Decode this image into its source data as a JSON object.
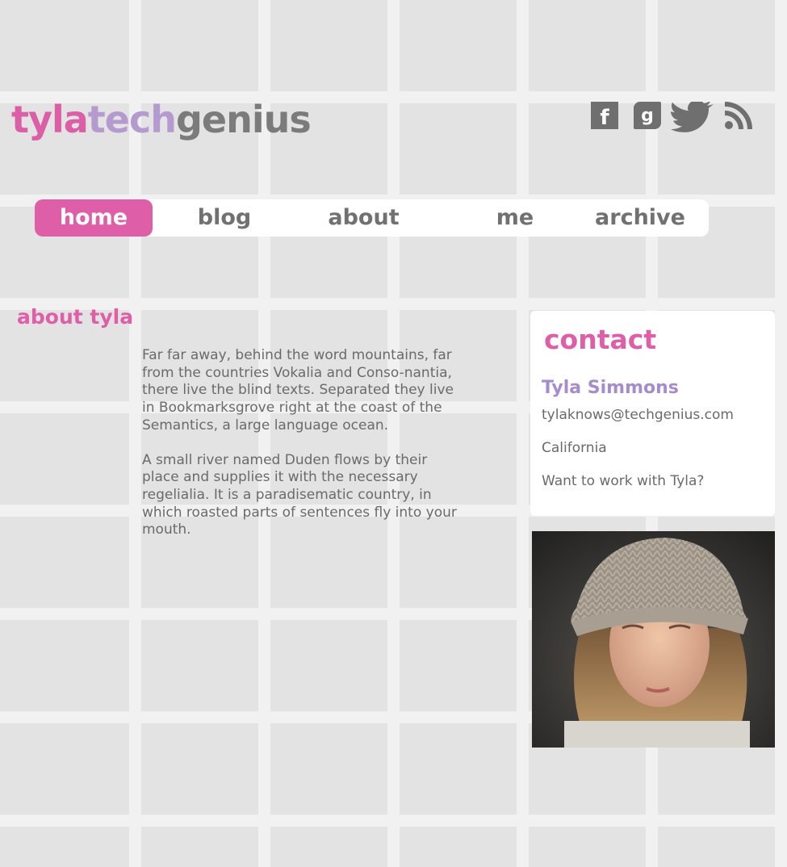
{
  "logo": {
    "part1": "tyla",
    "part2": "tech",
    "part3": "genius"
  },
  "social": {
    "facebook_glyph": "f",
    "googleplus_glyph": "g",
    "icons": [
      "facebook-icon",
      "google-plus-icon",
      "twitter-icon",
      "rss-icon"
    ]
  },
  "nav": {
    "items": [
      {
        "label": "home",
        "active": true
      },
      {
        "label": "blog",
        "active": false
      },
      {
        "label": "about",
        "active": false
      },
      {
        "label": "me",
        "active": false
      },
      {
        "label": "archive",
        "active": false
      }
    ]
  },
  "main": {
    "title": "about tyla",
    "paragraphs": [
      "Far far away, behind the word mountains, far from the countries Vokalia and Conso-nantia, there live the blind texts. Separated they live in Bookmarksgrove right at the coast of the Semantics, a large language ocean.",
      "A small river named Duden flows by their place and supplies it with the necessary regelialia. It is a paradisematic country, in which roasted parts of sentences fly into your mouth."
    ]
  },
  "contact": {
    "title": "contact",
    "name": "Tyla Simmons",
    "email": "tylaknows@techgenius.com",
    "location": "California",
    "cta": "Want to work with Tyla?"
  },
  "colors": {
    "pink": "#de5fa8",
    "lavender": "#b59ad0",
    "gray": "#7b7b7b",
    "grid": "#f1f1f1"
  }
}
